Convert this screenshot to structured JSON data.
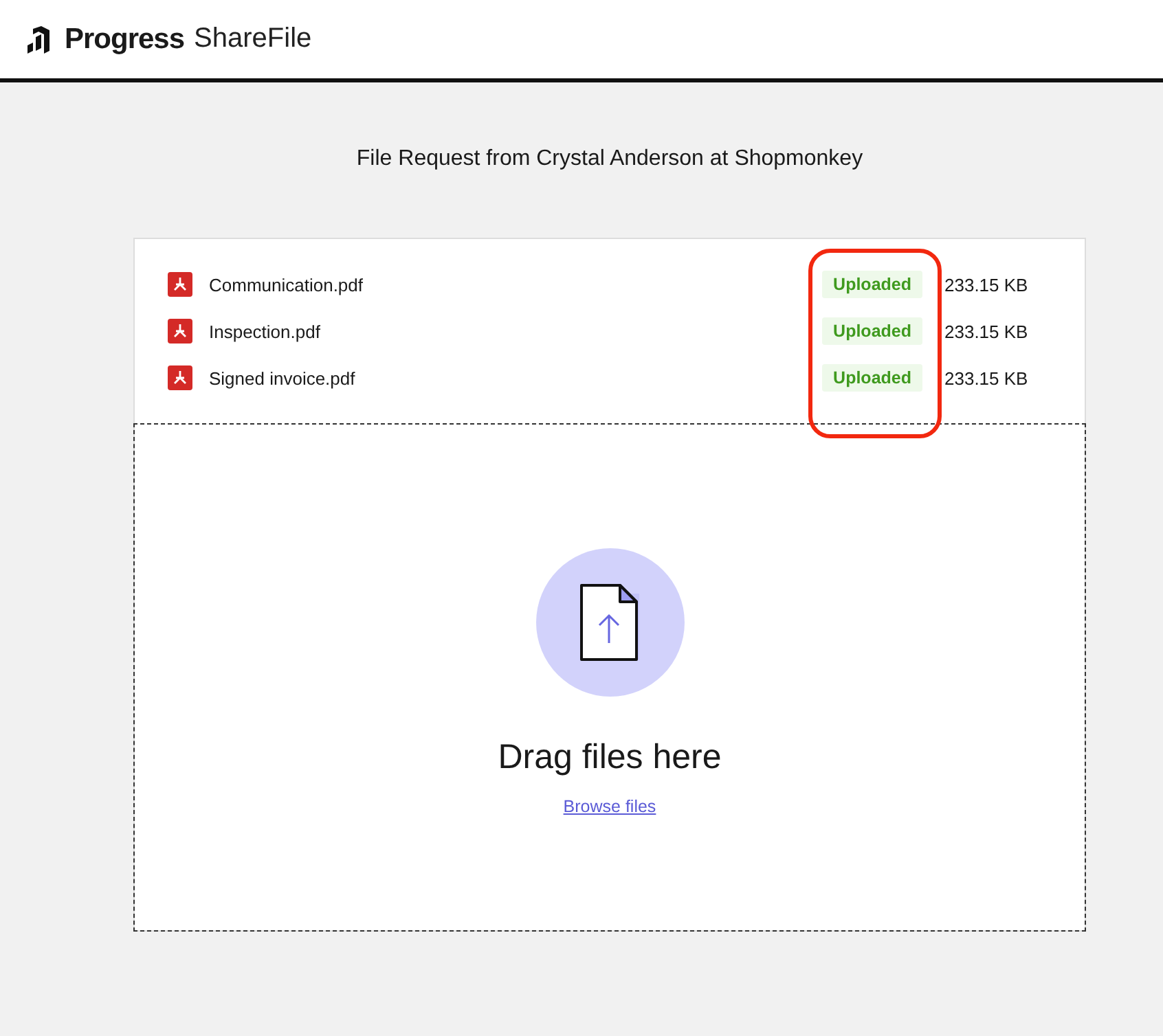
{
  "header": {
    "brand": "Progress",
    "product": "ShareFile"
  },
  "title": "File Request from Crystal Anderson at Shopmonkey",
  "files": [
    {
      "name": "Communication.pdf",
      "status": "Uploaded",
      "size": "233.15 KB"
    },
    {
      "name": "Inspection.pdf",
      "status": "Uploaded",
      "size": "233.15 KB"
    },
    {
      "name": "Signed invoice.pdf",
      "status": "Uploaded",
      "size": "233.15 KB"
    }
  ],
  "dropzone": {
    "prompt": "Drag files here",
    "link": "Browse files"
  }
}
